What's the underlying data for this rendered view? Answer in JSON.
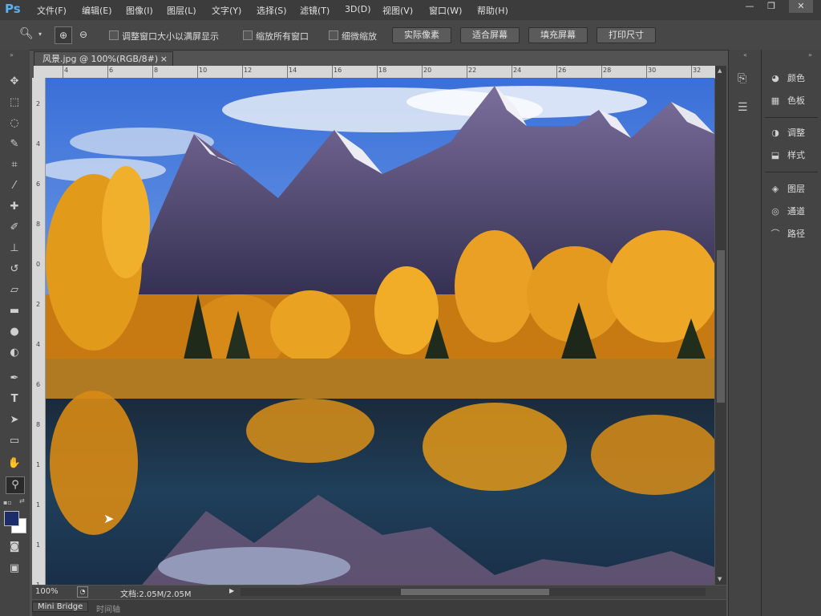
{
  "app": {
    "logo": "Ps"
  },
  "menu": [
    "文件(F)",
    "编辑(E)",
    "图像(I)",
    "图层(L)",
    "文字(Y)",
    "选择(S)",
    "滤镜(T)",
    "3D(D)",
    "视图(V)",
    "窗口(W)",
    "帮助(H)"
  ],
  "window_controls": {
    "minimize": "—",
    "restore": "❐",
    "close": "✕"
  },
  "options_bar": {
    "checkboxes": [
      "调整窗口大小以满屏显示",
      "缩放所有窗口",
      "细微缩放"
    ],
    "buttons": [
      "实际像素",
      "适合屏幕",
      "填充屏幕",
      "打印尺寸"
    ]
  },
  "document": {
    "tab_title": "风景.jpg @ 100%(RGB/8#)",
    "tab_close": "×",
    "zoom": "100%",
    "doc_size": "文档:2.05M/2.05M"
  },
  "rulers": {
    "top": [
      "4",
      "6",
      "8",
      "10",
      "12",
      "14",
      "16",
      "18",
      "20",
      "22",
      "24",
      "26",
      "28",
      "30",
      "32"
    ],
    "left": [
      "2",
      "4",
      "6",
      "8",
      "0",
      "2",
      "4",
      "6",
      "8",
      "1",
      "1",
      "1",
      "1"
    ]
  },
  "bottom_tabs": [
    "Mini Bridge",
    "时间轴"
  ],
  "panels": {
    "group1": [
      "颜色",
      "色板"
    ],
    "group2": [
      "调整",
      "样式"
    ],
    "group3": [
      "图层",
      "通道",
      "路径"
    ]
  },
  "colors": {
    "foreground": "#1c2d6a",
    "background": "#ffffff"
  }
}
